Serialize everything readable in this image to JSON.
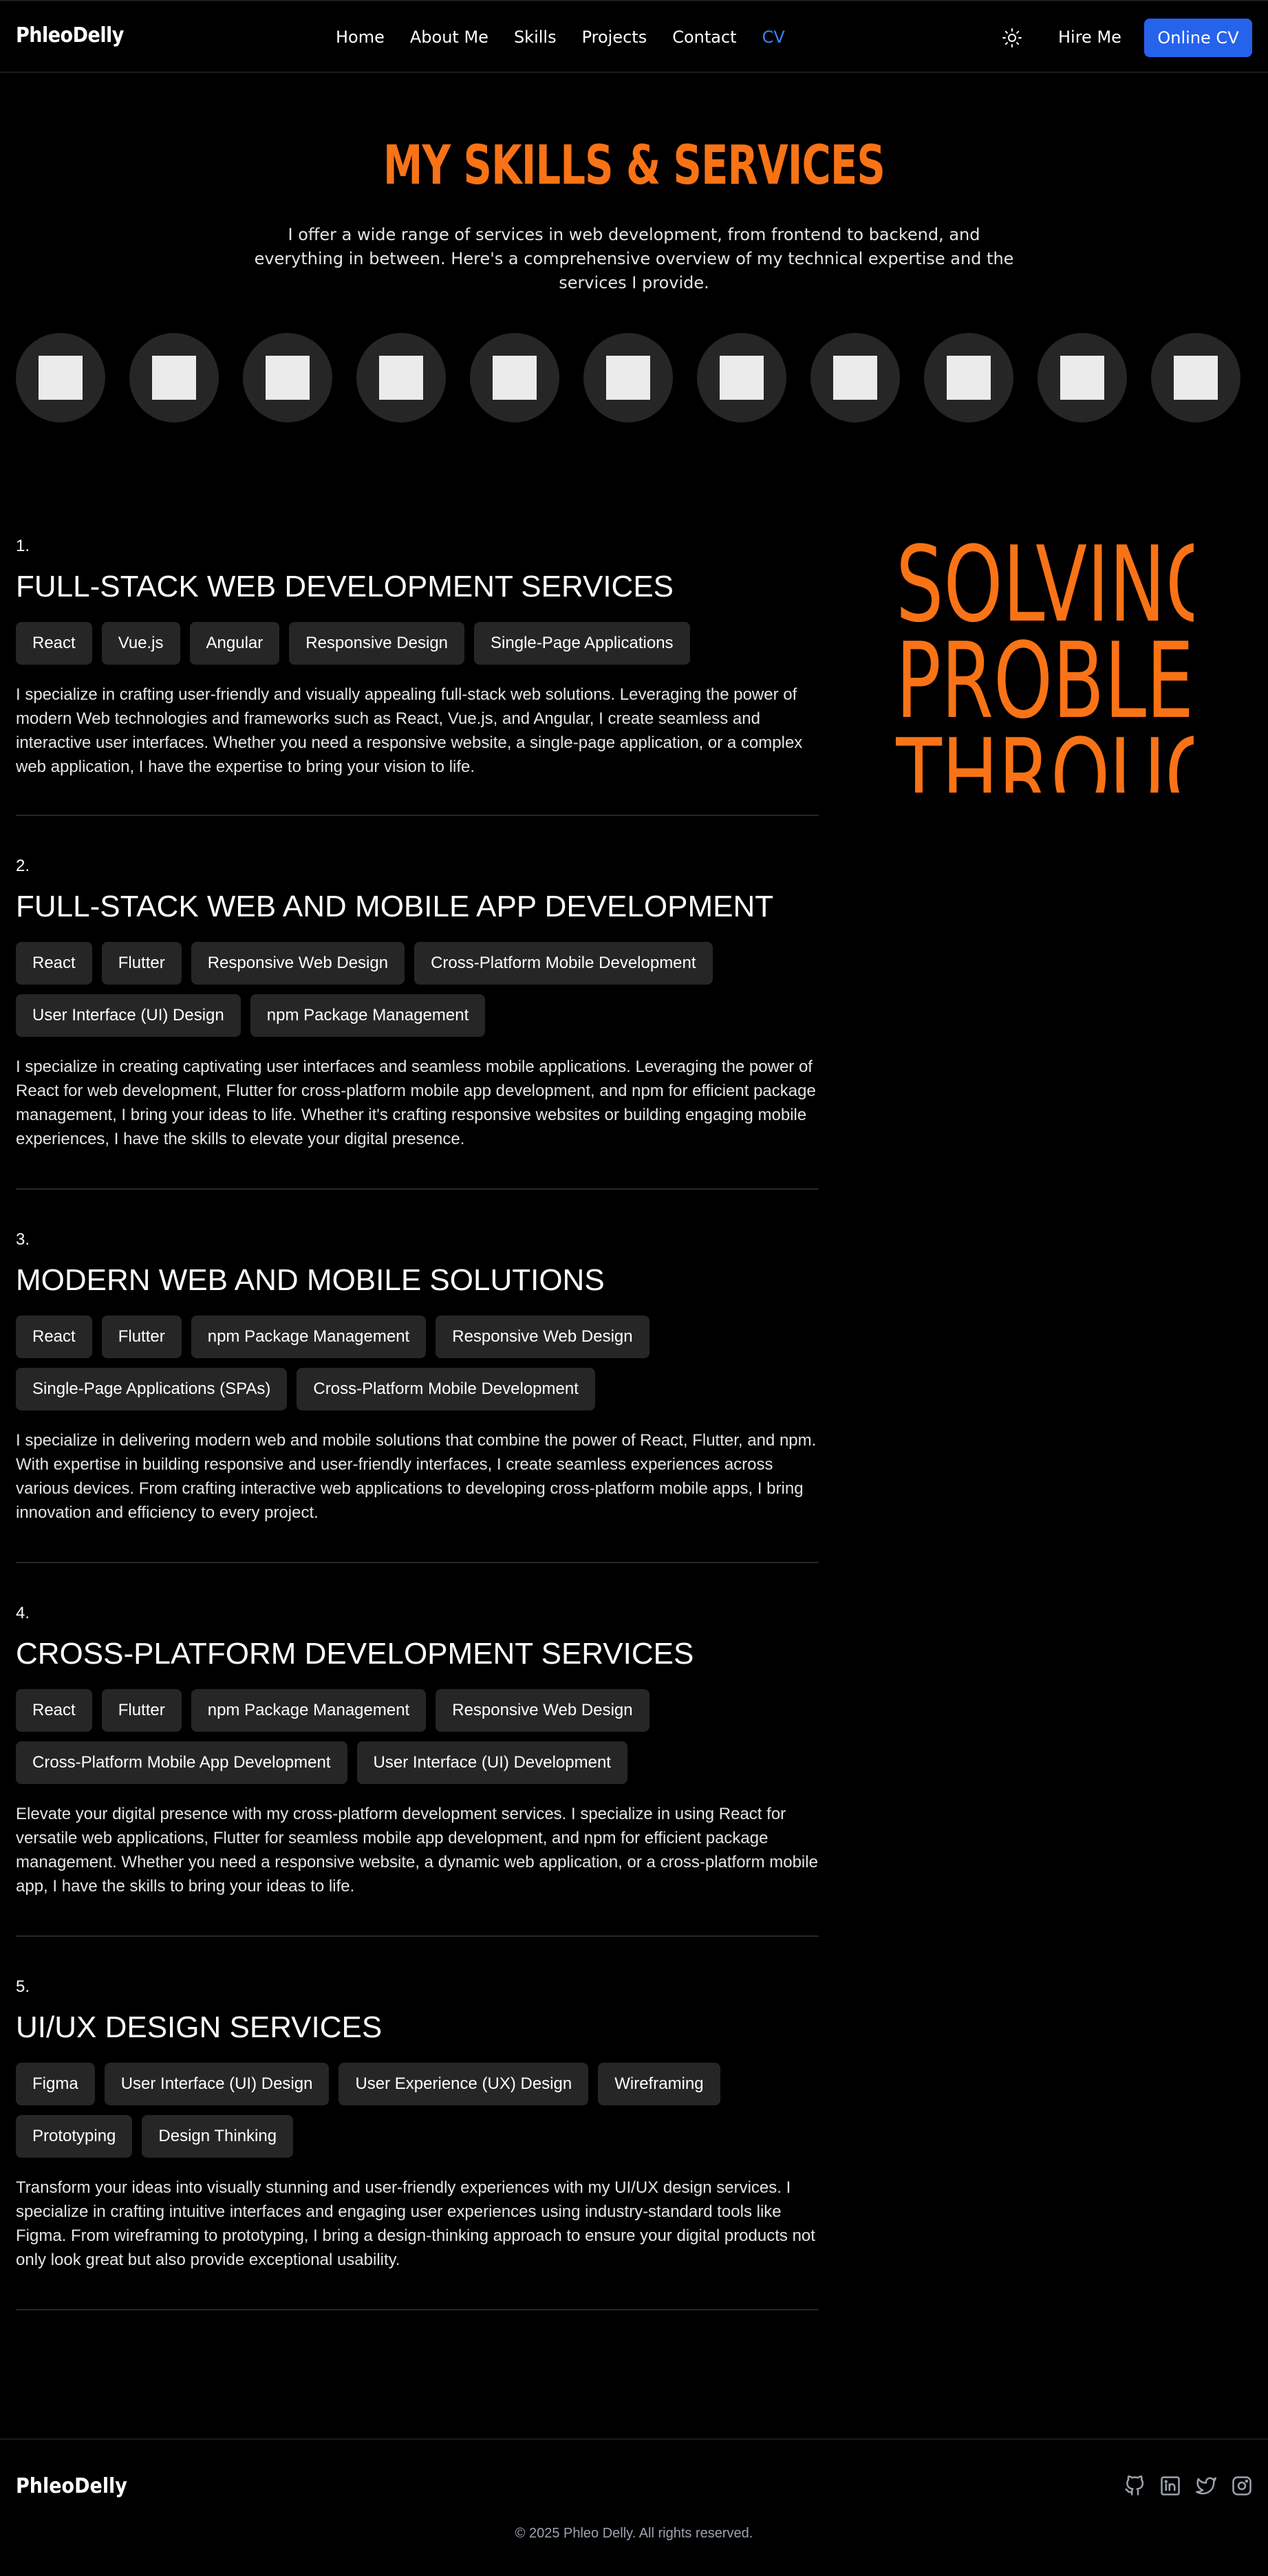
{
  "nav": {
    "logo": "PhleoDelly",
    "menu": [
      "Home",
      "About Me",
      "Skills",
      "Projects",
      "Contact",
      "CV"
    ],
    "hire_label": "Hire Me",
    "online_cv_label": "Online CV"
  },
  "hero": {
    "title": "MY SKILLS & SERVICES",
    "subtitle": "I offer a wide range of services in web development, from frontend to backend, and everything in between. Here's a comprehensive overview of my technical expertise and the services I provide."
  },
  "skill_icons_count": 11,
  "side_text": [
    "SOLVING",
    "PROBLEMS",
    "THROUGH"
  ],
  "services": [
    {
      "number": "1.",
      "title": "FULL-STACK WEB DEVELOPMENT SERVICES",
      "tags": [
        "React",
        "Vue.js",
        "Angular",
        "Responsive Design",
        "Single-Page Applications"
      ],
      "description": "I specialize in crafting user-friendly and visually appealing full-stack web solutions. Leveraging the power of modern Web technologies and frameworks such as React, Vue.js, and Angular, I create seamless and interactive user interfaces. Whether you need a responsive website, a single-page application, or a complex web application, I have the expertise to bring your vision to life."
    },
    {
      "number": "2.",
      "title": "FULL-STACK WEB AND MOBILE APP DEVELOPMENT",
      "tags": [
        "React",
        "Flutter",
        "Responsive Web Design",
        "Cross-Platform Mobile Development",
        "User Interface (UI) Design",
        "npm Package Management"
      ],
      "description": "I specialize in creating captivating user interfaces and seamless mobile applications. Leveraging the power of React for web development, Flutter for cross-platform mobile app development, and npm for efficient package management, I bring your ideas to life. Whether it's crafting responsive websites or building engaging mobile experiences, I have the skills to elevate your digital presence."
    },
    {
      "number": "3.",
      "title": "MODERN WEB AND MOBILE SOLUTIONS",
      "tags": [
        "React",
        "Flutter",
        "npm Package Management",
        "Responsive Web Design",
        "Single-Page Applications (SPAs)",
        "Cross-Platform Mobile Development"
      ],
      "description": "I specialize in delivering modern web and mobile solutions that combine the power of React, Flutter, and npm. With expertise in building responsive and user-friendly interfaces, I create seamless experiences across various devices. From crafting interactive web applications to developing cross-platform mobile apps, I bring innovation and efficiency to every project."
    },
    {
      "number": "4.",
      "title": "CROSS-PLATFORM DEVELOPMENT SERVICES",
      "tags": [
        "React",
        "Flutter",
        "npm Package Management",
        "Responsive Web Design",
        "Cross-Platform Mobile App Development",
        "User Interface (UI) Development"
      ],
      "description": "Elevate your digital presence with my cross-platform development services. I specialize in using React for versatile web applications, Flutter for seamless mobile app development, and npm for efficient package management. Whether you need a responsive website, a dynamic web application, or a cross-platform mobile app, I have the skills to bring your ideas to life."
    },
    {
      "number": "5.",
      "title": "UI/UX DESIGN SERVICES",
      "tags": [
        "Figma",
        "User Interface (UI) Design",
        "User Experience (UX) Design",
        "Wireframing",
        "Prototyping",
        "Design Thinking"
      ],
      "description": "Transform your ideas into visually stunning and user-friendly experiences with my UI/UX design services. I specialize in crafting intuitive interfaces and engaging user experiences using industry-standard tools like Figma. From wireframing to prototyping, I bring a design-thinking approach to ensure your digital products not only look great but also provide exceptional usability."
    }
  ],
  "footer": {
    "logo": "PhleoDelly",
    "social_icons": [
      "github-icon",
      "linkedin-icon",
      "twitter-icon",
      "instagram-icon"
    ],
    "copyright": "© 2025 Phleo Delly. All rights reserved."
  },
  "colors": {
    "accent": "#f97316",
    "button": "#2563eb",
    "cv_link": "#3b82f6",
    "tag_bg": "#262626",
    "background": "#000000"
  }
}
